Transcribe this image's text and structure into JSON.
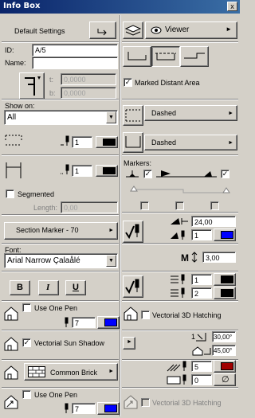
{
  "window": {
    "title": "Info Box",
    "close_label": "x"
  },
  "settings": {
    "default_label": "Default Settings",
    "viewer_label": "Viewer"
  },
  "fields": {
    "id_label": "ID:",
    "id_value": "A/5",
    "name_label": "Name:",
    "name_value": "",
    "t_label": "t:",
    "t_value": "0,0000",
    "b_label": "b:",
    "b_value": "0,0000",
    "marked_distant_area": "Marked Distant Area"
  },
  "show_on": {
    "label": "Show on:",
    "value": "All"
  },
  "line1": {
    "type": "Dashed",
    "pen": "1"
  },
  "line2": {
    "type": "Dashed",
    "pen": "1"
  },
  "markers": {
    "label": "Markers:"
  },
  "segmented": {
    "label": "Segmented",
    "length_label": "Length:",
    "length_value": "0,00"
  },
  "marker": {
    "label": "Section Marker - 70",
    "size": "24,00",
    "pen": "1"
  },
  "font": {
    "label": "Font:",
    "value": "Arial Narrow Çalaålé",
    "size": "3,00"
  },
  "text_style": {
    "bold": "B",
    "italic": "I",
    "underline": "U",
    "pen1": "1",
    "pen2": "2"
  },
  "hatch1": {
    "use_one_pen": "Use One Pen",
    "pen": "7",
    "vectorial_3d": "Vectorial 3D Hatching"
  },
  "sun_shadow": {
    "label": "Vectorial Sun Shadow",
    "angle1": "30,00°",
    "angle2": "45,00°"
  },
  "fill": {
    "label": "Common Brick",
    "pen1": "5",
    "pen2": "0"
  },
  "hatch2": {
    "use_one_pen": "Use One Pen",
    "pen": "7",
    "vectorial_3d": "Vectorial 3D Hatching"
  },
  "colors": {
    "blue": "#0000ff",
    "black": "#000000",
    "dark_red": "#a00000",
    "title": "#0a246a"
  }
}
